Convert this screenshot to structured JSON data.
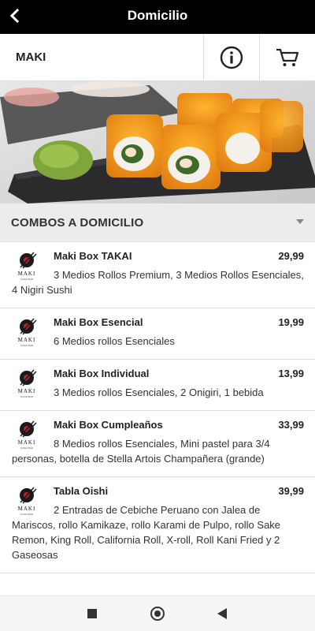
{
  "header": {
    "title": "Domicilio",
    "back_icon": "back-arrow-icon"
  },
  "store": {
    "name": "MAKI",
    "info_icon": "info-icon",
    "cart_icon": "cart-icon"
  },
  "hero": {
    "subject": "sushi-rolls-photo"
  },
  "section": {
    "title": "COMBOS A DOMICILIO",
    "toggle_icon": "caret-down-icon"
  },
  "brand": {
    "logo_text": "MAKI",
    "logo_sub": "SUSHI BAR",
    "accent_color": "#b3262d"
  },
  "items": [
    {
      "name": "Maki Box TAKAI",
      "price": "29,99",
      "description": "3 Medios Rollos Premium, 3 Medios Rollos Esenciales, 4 Nigiri Sushi"
    },
    {
      "name": "Maki Box Esencial",
      "price": "19,99",
      "description": "6 Medios rollos Esenciales"
    },
    {
      "name": "Maki Box Individual",
      "price": "13,99",
      "description": "3 Medios rollos Esenciales, 2 Onigiri, 1 bebida"
    },
    {
      "name": "Maki Box Cumpleaños",
      "price": "33,99",
      "description": "8 Medios rollos Esenciales, Mini pastel para 3/4 personas, botella de Stella Artois Champañera (grande)"
    },
    {
      "name": "Tabla Oishi",
      "price": "39,99",
      "description": "2 Entradas de Cebiche Peruano con Jalea de Mariscos, rollo Kamikaze, rollo Karami de Pulpo, rollo Sake Remon, King Roll, California Roll, X-roll, Roll Kani Fried y 2 Gaseosas"
    }
  ],
  "system_nav": {
    "recents_icon": "square-icon",
    "home_icon": "circle-home-icon",
    "back_icon": "triangle-back-icon"
  }
}
